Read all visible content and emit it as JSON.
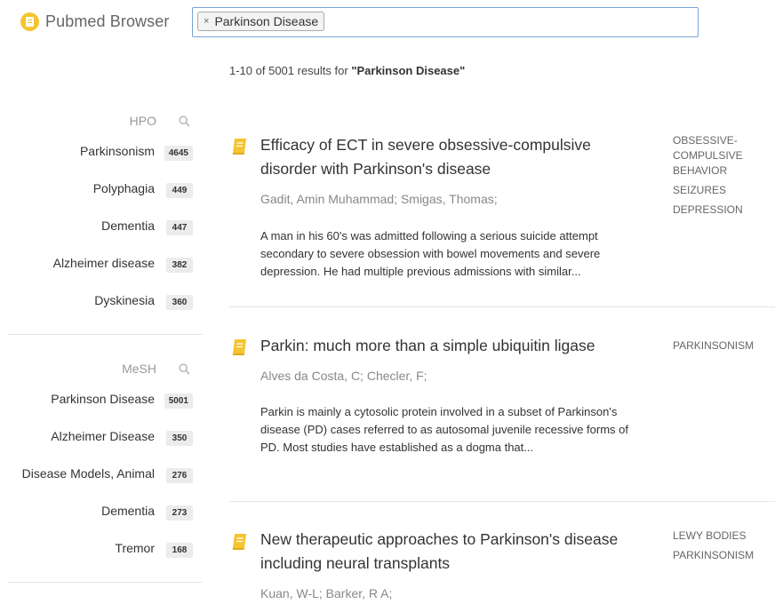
{
  "app": {
    "title": "Pubmed Browser"
  },
  "search": {
    "chips": [
      {
        "label": "Parkinson Disease",
        "remove_glyph": "×"
      }
    ]
  },
  "results_summary": {
    "prefix": "1-10 of 5001 results for",
    "query": "\"Parkinson Disease\""
  },
  "sidebar": {
    "facets": [
      {
        "title": "HPO",
        "icon": "search-icon",
        "items": [
          {
            "label": "Parkinsonism",
            "count": "4645"
          },
          {
            "label": "Polyphagia",
            "count": "449"
          },
          {
            "label": "Dementia",
            "count": "447"
          },
          {
            "label": "Alzheimer disease",
            "count": "382"
          },
          {
            "label": "Dyskinesia",
            "count": "360"
          }
        ]
      },
      {
        "title": "MeSH",
        "icon": "search-icon",
        "items": [
          {
            "label": "Parkinson Disease",
            "count": "5001"
          },
          {
            "label": "Alzheimer Disease",
            "count": "350"
          },
          {
            "label": "Disease Models, Animal",
            "count": "276"
          },
          {
            "label": "Dementia",
            "count": "273"
          },
          {
            "label": "Tremor",
            "count": "168"
          }
        ]
      }
    ]
  },
  "results": [
    {
      "icon": "book-icon",
      "title": "Efficacy of ECT in severe obsessive-compulsive disorder with Parkinson's disease",
      "authors": "Gadit, Amin Muhammad;  Smigas, Thomas;",
      "abstract": "A man in his 60's was admitted following a serious suicide attempt secondary to severe obsession with bowel movements and severe depression. He had multiple previous admissions with similar...",
      "tags": [
        "OBSESSIVE-COMPULSIVE BEHAVIOR",
        "SEIZURES",
        "DEPRESSION"
      ]
    },
    {
      "icon": "book-icon",
      "title": "Parkin: much more than a simple ubiquitin ligase",
      "authors": "Alves da Costa, C;  Checler, F;",
      "abstract": "Parkin is mainly a cytosolic protein involved in a subset of Parkinson's disease (PD) cases referred to as autosomal juvenile recessive forms of PD. Most studies have established as a dogma that...",
      "tags": [
        "PARKINSONISM"
      ]
    },
    {
      "icon": "book-icon",
      "title": "New therapeutic approaches to Parkinson's disease including neural transplants",
      "authors": "Kuan, W-L;  Barker, R A;",
      "abstract": "",
      "tags": [
        "LEWY BODIES",
        "PARKINSONISM"
      ]
    }
  ],
  "colors": {
    "brand": "#f6c431",
    "focus_border": "#79a3d6"
  }
}
